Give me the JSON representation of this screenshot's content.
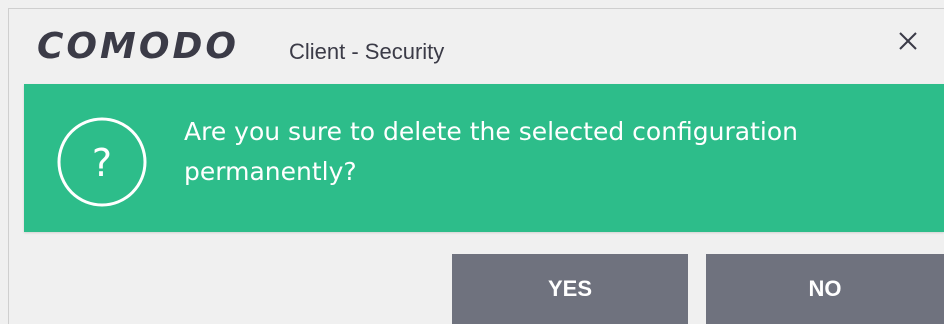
{
  "window": {
    "brand": "COMODO",
    "title": "Client - Security"
  },
  "dialog": {
    "icon": "question-circle-icon",
    "message": "Are you sure to delete the selected configuration permanently?",
    "yes_label": "YES",
    "no_label": "NO"
  },
  "colors": {
    "banner": "#2dbd8a",
    "button": "#6f727e",
    "brand_text": "#3b3b47",
    "background": "#f0f0f0"
  }
}
